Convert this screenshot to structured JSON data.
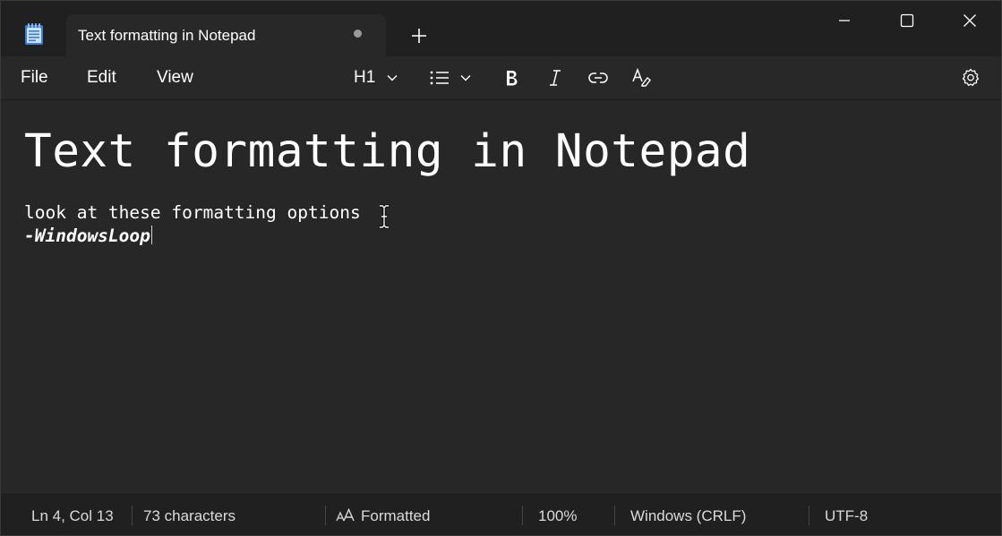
{
  "app": {
    "tab_title": "Text formatting in Notepad",
    "unsaved_indicator": "dot",
    "icon": "notepad-icon"
  },
  "window_controls": {
    "minimize_icon": "minimize-icon",
    "maximize_icon": "maximize-icon",
    "close_icon": "close-icon"
  },
  "menu": {
    "file": "File",
    "edit": "Edit",
    "view": "View"
  },
  "toolbar": {
    "heading_label": "H1",
    "icons": [
      "chevron-down-icon",
      "list-icon",
      "bold-icon",
      "italic-icon",
      "link-icon",
      "clear-formatting-icon",
      "gear-icon"
    ]
  },
  "document": {
    "heading": "Text formatting in Notepad",
    "line1": "look at these formatting options",
    "line2": "-WindowsLoop"
  },
  "status": {
    "position": "Ln 4, Col 13",
    "characters": "73 characters",
    "format": "Formatted",
    "zoom": "100%",
    "line_ending": "Windows (CRLF)",
    "encoding": "UTF-8"
  },
  "colors": {
    "background": "#272727",
    "titlebar": "#202020",
    "text": "#ffffff"
  }
}
